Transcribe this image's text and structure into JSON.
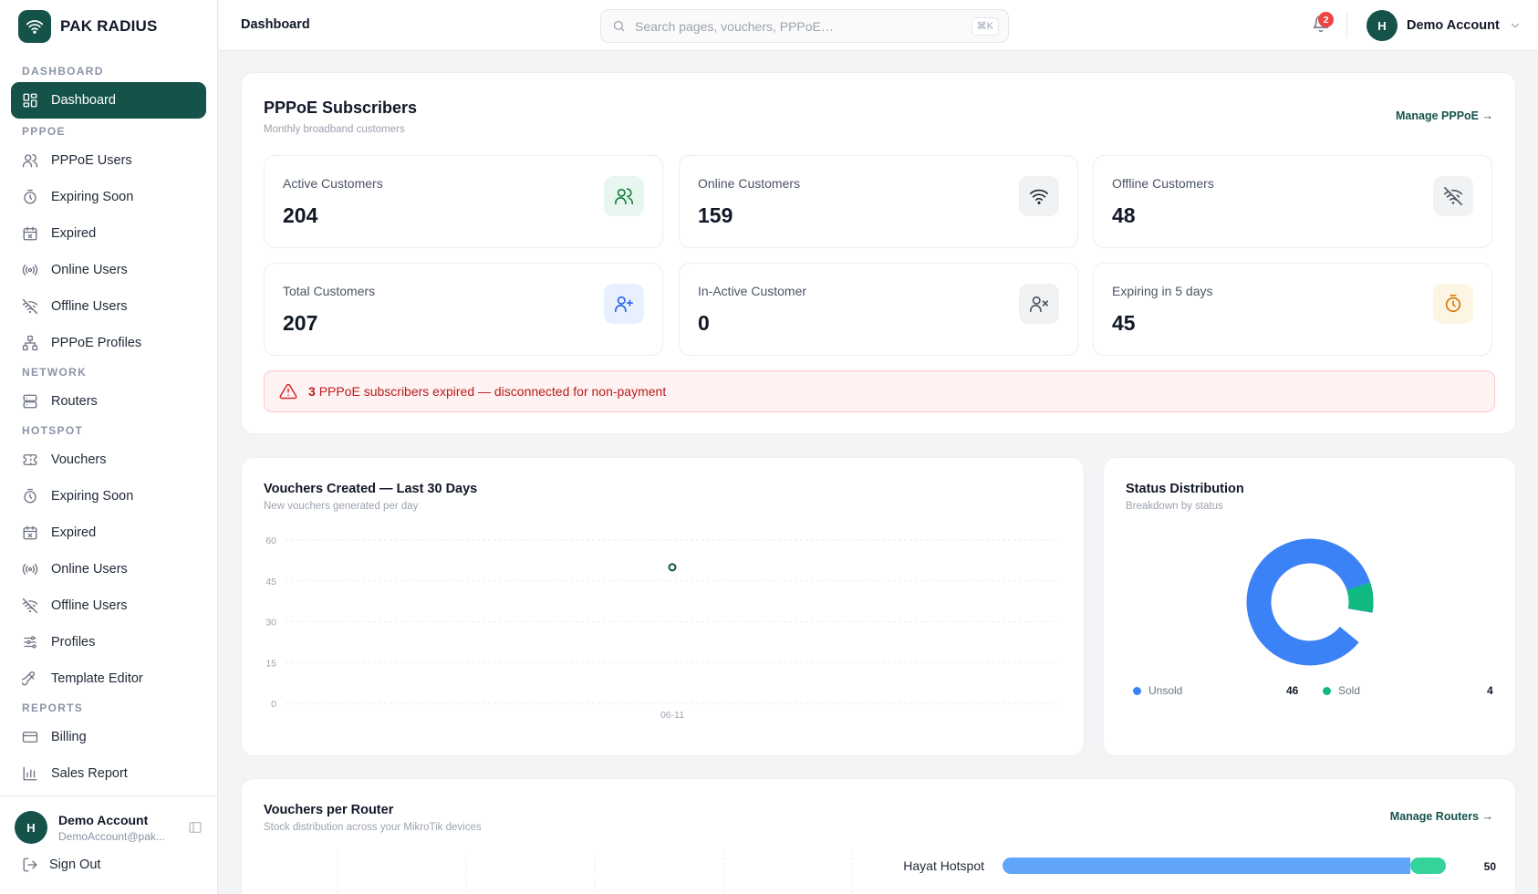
{
  "brand": {
    "name": "PAK RADIUS",
    "icon": "wifi-icon",
    "color": "#14524a"
  },
  "sidebar": {
    "sections": [
      {
        "title": "DASHBOARD",
        "items": [
          {
            "label": "Dashboard",
            "icon": "dashboard-icon",
            "active": true
          }
        ]
      },
      {
        "title": "PPPOE",
        "items": [
          {
            "label": "PPPoE Users",
            "icon": "users-icon"
          },
          {
            "label": "Expiring Soon",
            "icon": "timer-icon"
          },
          {
            "label": "Expired",
            "icon": "calendar-x-icon"
          },
          {
            "label": "Online Users",
            "icon": "broadcast-icon"
          },
          {
            "label": "Offline Users",
            "icon": "wifi-off-icon"
          },
          {
            "label": "PPPoE Profiles",
            "icon": "network-icon"
          }
        ]
      },
      {
        "title": "NETWORK",
        "items": [
          {
            "label": "Routers",
            "icon": "server-icon"
          }
        ]
      },
      {
        "title": "HOTSPOT",
        "items": [
          {
            "label": "Vouchers",
            "icon": "ticket-icon"
          },
          {
            "label": "Expiring Soon",
            "icon": "timer-icon"
          },
          {
            "label": "Expired",
            "icon": "calendar-x-icon"
          },
          {
            "label": "Online Users",
            "icon": "broadcast-icon"
          },
          {
            "label": "Offline Users",
            "icon": "wifi-off-icon"
          },
          {
            "label": "Profiles",
            "icon": "sliders-icon"
          },
          {
            "label": "Template Editor",
            "icon": "brush-icon"
          }
        ]
      },
      {
        "title": "REPORTS",
        "items": [
          {
            "label": "Billing",
            "icon": "card-icon"
          },
          {
            "label": "Sales Report",
            "icon": "bar-chart-icon"
          }
        ]
      }
    ],
    "user": {
      "initial": "H",
      "name": "Demo Account",
      "email": "DemoAccount@pak..."
    },
    "signout": "Sign Out"
  },
  "header": {
    "title": "Dashboard",
    "search_placeholder": "Search pages, vouchers, PPPoE…",
    "shortcut": "⌘K",
    "notifications": "2",
    "account": {
      "initial": "H",
      "name": "Demo Account"
    }
  },
  "pppoe": {
    "title": "PPPoE Subscribers",
    "subtitle": "Monthly broadband customers",
    "manage": "Manage PPPoE →",
    "stats": [
      {
        "label": "Active Customers",
        "value": "204",
        "icon": "users-icon",
        "bg": "#e7f6ef",
        "color": "#15803d"
      },
      {
        "label": "Online Customers",
        "value": "159",
        "icon": "wifi-icon",
        "bg": "#f1f2f4",
        "color": "#1f2937"
      },
      {
        "label": "Offline Customers",
        "value": "48",
        "icon": "wifi-off-icon",
        "bg": "#f1f2f4",
        "color": "#4b5563"
      },
      {
        "label": "Total Customers",
        "value": "207",
        "icon": "user-plus-icon",
        "bg": "#e9f0fd",
        "color": "#2563eb"
      },
      {
        "label": "In-Active Customer",
        "value": "0",
        "icon": "user-x-icon",
        "bg": "#f1f2f4",
        "color": "#4b5563"
      },
      {
        "label": "Expiring in 5 days",
        "value": "45",
        "icon": "timer-icon",
        "bg": "#fdf5e3",
        "color": "#d97706"
      }
    ],
    "alert": {
      "count": "3",
      "message": "PPPoE subscribers expired — disconnected for non-payment"
    }
  },
  "vouchers_chart": {
    "title": "Vouchers Created — Last 30 Days",
    "subtitle": "New vouchers generated per day"
  },
  "status_chart": {
    "title": "Status Distribution",
    "subtitle": "Breakdown by status"
  },
  "router_chart": {
    "title": "Vouchers per Router",
    "subtitle": "Stock distribution across your MikroTik devices",
    "manage": "Manage Routers →"
  },
  "chart_data": [
    {
      "type": "line",
      "title": "Vouchers Created — Last 30 Days",
      "categories": [
        "06-11"
      ],
      "values": [
        50
      ],
      "ylim": [
        0,
        60
      ],
      "yticks": [
        "60",
        "45",
        "30",
        "15",
        "0"
      ],
      "grid": true,
      "color": "#14524a"
    },
    {
      "type": "pie",
      "title": "Status Distribution",
      "labels": [
        "Unsold",
        "Sold"
      ],
      "values": [
        46,
        4
      ],
      "colors": [
        "#3b82f6",
        "#10b981"
      ]
    },
    {
      "type": "bar",
      "title": "Vouchers per Router",
      "categories": [
        "Hayat Hotspot"
      ],
      "series": [
        {
          "name": "Unsold",
          "values": [
            46
          ]
        },
        {
          "name": "Sold",
          "values": [
            4
          ]
        }
      ],
      "totals": [
        "50"
      ],
      "colors": [
        "#60a5fa",
        "#34d399"
      ]
    }
  ]
}
